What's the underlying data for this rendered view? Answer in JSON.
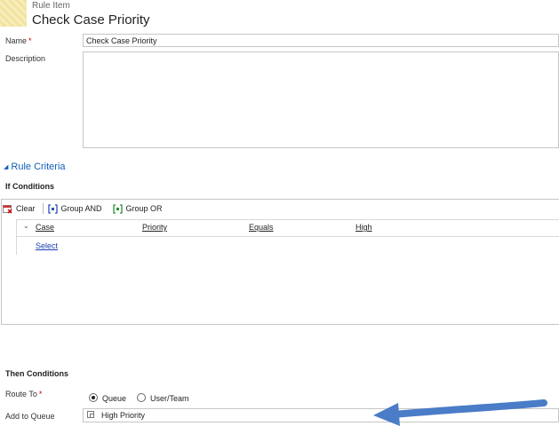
{
  "header": {
    "entity_type": "Rule Item",
    "title": "Check Case Priority"
  },
  "form": {
    "name_label": "Name",
    "required_mark": "*",
    "name_value": "Check Case Priority",
    "description_label": "Description",
    "description_value": ""
  },
  "rule_criteria": {
    "section_label": "Rule Criteria",
    "if_conditions_label": "If Conditions",
    "toolbar": {
      "clear": "Clear",
      "group_and": "Group AND",
      "group_or": "Group OR"
    },
    "condition": {
      "entity": "Case",
      "field": "Priority",
      "operator": "Equals",
      "value": "High"
    },
    "select_label": "Select"
  },
  "then_conditions": {
    "label": "Then Conditions",
    "route_to_label": "Route To",
    "route_options": [
      {
        "label": "Queue",
        "selected": true
      },
      {
        "label": "User/Team",
        "selected": false
      }
    ],
    "add_to_queue_label": "Add to Queue",
    "queue_value": "High Priority"
  },
  "colors": {
    "link": "#1160b7",
    "arrow": "#4a7cc7",
    "required": "#cc0000"
  }
}
